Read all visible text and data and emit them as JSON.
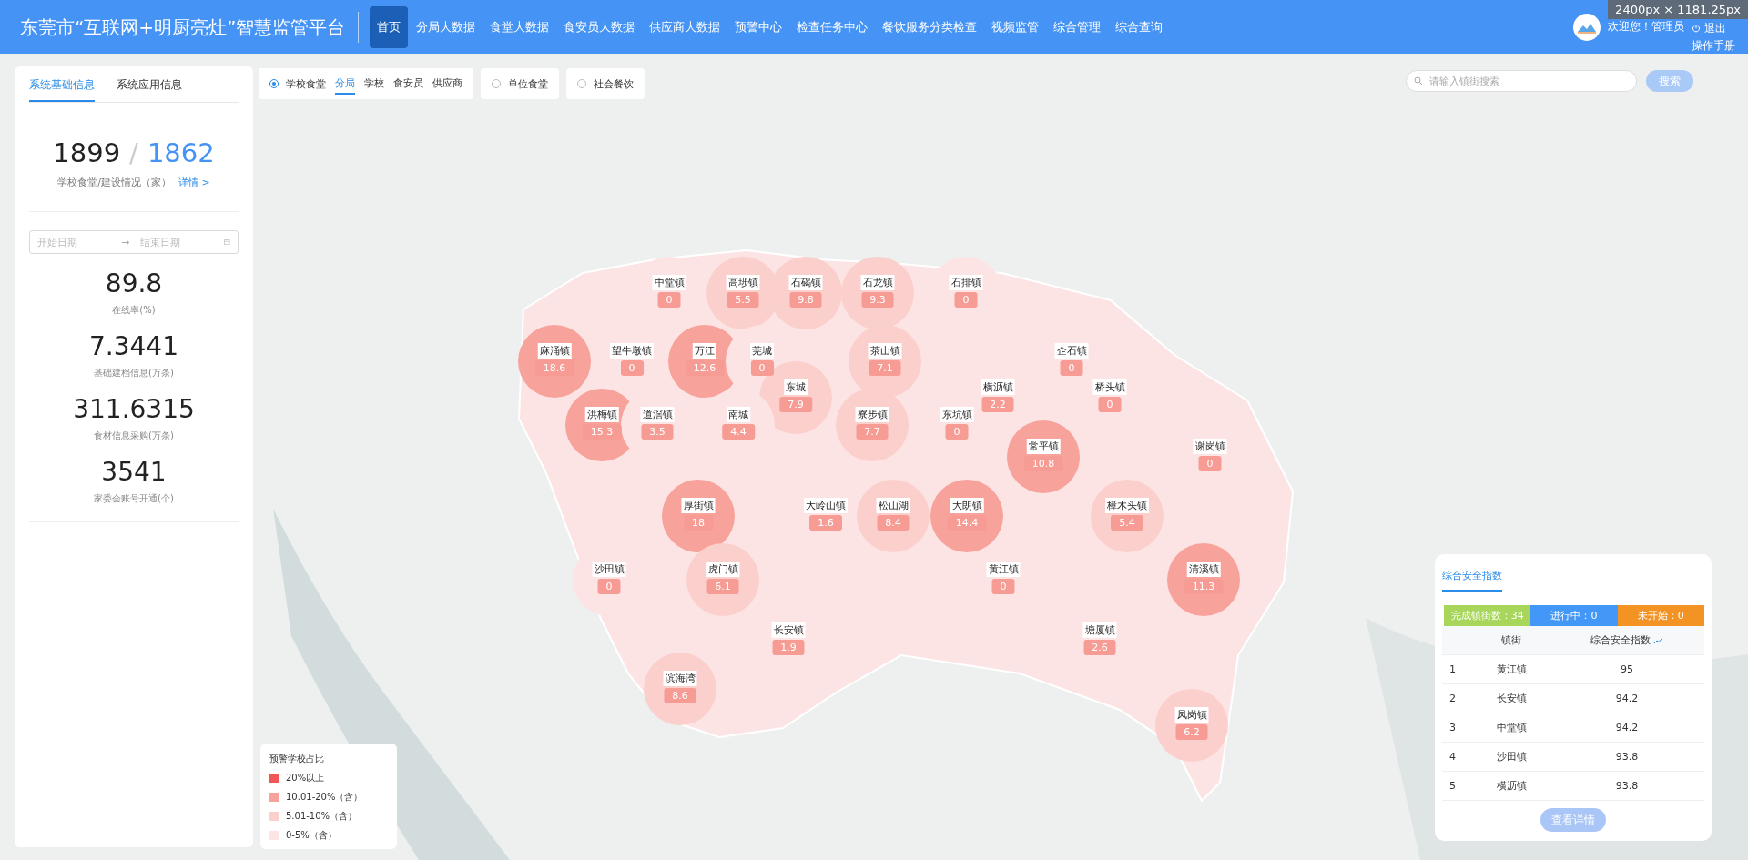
{
  "header": {
    "title": "东莞市“互联网+明厨亮灶”智慧监管平台",
    "nav": [
      {
        "label": "首页",
        "selected": true
      },
      {
        "label": "分局大数据",
        "selected": false
      },
      {
        "label": "食堂大数据",
        "selected": false
      },
      {
        "label": "食安员大数据",
        "selected": false
      },
      {
        "label": "供应商大数据",
        "selected": false
      },
      {
        "label": "预警中心",
        "selected": false
      },
      {
        "label": "检查任务中心",
        "selected": false
      },
      {
        "label": "餐饮服务分类检查",
        "selected": false
      },
      {
        "label": "视频监管",
        "selected": false
      },
      {
        "label": "综合管理",
        "selected": false
      },
      {
        "label": "综合查询",
        "selected": false
      }
    ],
    "welcome": "欢迎您！管理员",
    "logout": "退出",
    "manual": "操作手册"
  },
  "size_tooltip": "2400px × 1181.25px",
  "left_panel": {
    "tabs": [
      {
        "label": "系统基础信息",
        "selected": true
      },
      {
        "label": "系统应用信息",
        "selected": false
      }
    ],
    "total": "1899",
    "separator": "/",
    "built": "1862",
    "summary_label": "学校食堂/建设情况（家）",
    "details_link": "详情 >",
    "date_range": {
      "start_placeholder": "开始日期",
      "arrow": "→",
      "end_placeholder": "结束日期"
    },
    "stats": [
      {
        "value": "89.8",
        "label": "在线率(%)"
      },
      {
        "value": "7.3441",
        "label": "基础建档信息(万条)"
      },
      {
        "value": "311.6315",
        "label": "食材信息采购(万条)"
      },
      {
        "value": "3541",
        "label": "家委会账号开通(个)"
      }
    ]
  },
  "filters": [
    {
      "label": "学校食堂",
      "selected": true,
      "sub_tabs": [
        {
          "label": "分局",
          "selected": true
        },
        {
          "label": "学校",
          "selected": false
        },
        {
          "label": "食安员",
          "selected": false
        },
        {
          "label": "供应商",
          "selected": false
        }
      ]
    },
    {
      "label": "单位食堂",
      "selected": false
    },
    {
      "label": "社会餐饮",
      "selected": false
    }
  ],
  "search": {
    "placeholder": "请输入镇街搜索",
    "button": "搜索"
  },
  "map": {
    "towns": [
      {
        "name": "中堂镇",
        "value": "0",
        "color": "#fde4e4"
      },
      {
        "name": "高埗镇",
        "value": "5.5",
        "color": "#fbcfcc"
      },
      {
        "name": "石碣镇",
        "value": "9.8",
        "color": "#fbcfcc"
      },
      {
        "name": "石龙镇",
        "value": "9.3",
        "color": "#fbcfcc"
      },
      {
        "name": "石排镇",
        "value": "0",
        "color": "#fde4e4"
      },
      {
        "name": "麻涌镇",
        "value": "18.6",
        "color": "#f7a29b"
      },
      {
        "name": "望牛墩镇",
        "value": "0",
        "color": "#fde4e4"
      },
      {
        "name": "万江",
        "value": "12.6",
        "color": "#f7a29b"
      },
      {
        "name": "莞城",
        "value": "0",
        "color": "#fde4e4"
      },
      {
        "name": "茶山镇",
        "value": "7.1",
        "color": "#fbcfcc"
      },
      {
        "name": "企石镇",
        "value": "0",
        "color": "#fde4e4"
      },
      {
        "name": "东城",
        "value": "7.9",
        "color": "#fbcfcc"
      },
      {
        "name": "横沥镇",
        "value": "2.2",
        "color": "#fde4e4"
      },
      {
        "name": "桥头镇",
        "value": "0",
        "color": "#fde4e4"
      },
      {
        "name": "洪梅镇",
        "value": "15.3",
        "color": "#f7a29b"
      },
      {
        "name": "道滘镇",
        "value": "3.5",
        "color": "#fde4e4"
      },
      {
        "name": "南城",
        "value": "4.4",
        "color": "#fde4e4"
      },
      {
        "name": "寮步镇",
        "value": "7.7",
        "color": "#fbcfcc"
      },
      {
        "name": "东坑镇",
        "value": "0",
        "color": "#fde4e4"
      },
      {
        "name": "常平镇",
        "value": "10.8",
        "color": "#f7a29b"
      },
      {
        "name": "谢岗镇",
        "value": "0",
        "color": "#fde4e4"
      },
      {
        "name": "厚街镇",
        "value": "18",
        "color": "#f7a29b"
      },
      {
        "name": "大岭山镇",
        "value": "1.6",
        "color": "#fde4e4"
      },
      {
        "name": "松山湖",
        "value": "8.4",
        "color": "#fbcfcc"
      },
      {
        "name": "大朗镇",
        "value": "14.4",
        "color": "#f7a29b"
      },
      {
        "name": "樟木头镇",
        "value": "5.4",
        "color": "#fbcfcc"
      },
      {
        "name": "沙田镇",
        "value": "0",
        "color": "#fde4e4"
      },
      {
        "name": "虎门镇",
        "value": "6.1",
        "color": "#fbcfcc"
      },
      {
        "name": "黄江镇",
        "value": "0",
        "color": "#fde4e4"
      },
      {
        "name": "清溪镇",
        "value": "11.3",
        "color": "#f7a29b"
      },
      {
        "name": "长安镇",
        "value": "1.9",
        "color": "#fde4e4"
      },
      {
        "name": "塘厦镇",
        "value": "2.6",
        "color": "#fde4e4"
      },
      {
        "name": "滨海湾",
        "value": "8.6",
        "color": "#fbcfcc"
      },
      {
        "name": "凤岗镇",
        "value": "6.2",
        "color": "#fbcfcc"
      }
    ]
  },
  "legend": {
    "title": "预警学校占比",
    "items": [
      {
        "label": "20%以上",
        "color": "#f25757"
      },
      {
        "label": "10.01-20%（含）",
        "color": "#f7a29b"
      },
      {
        "label": "5.01-10%（含）",
        "color": "#fbcfcc"
      },
      {
        "label": "0-5%（含）",
        "color": "#fde4e4"
      }
    ]
  },
  "safety_panel": {
    "tab": "综合安全指数",
    "statuses": [
      {
        "label": "完成镇街数：34",
        "kind": "done"
      },
      {
        "label": "进行中：0",
        "kind": "progress"
      },
      {
        "label": "未开始：0",
        "kind": "pending"
      }
    ],
    "columns": [
      "镇街",
      "综合安全指数"
    ],
    "rows": [
      {
        "rank": "1",
        "town": "黄江镇",
        "score": "95"
      },
      {
        "rank": "2",
        "town": "长安镇",
        "score": "94.2"
      },
      {
        "rank": "3",
        "town": "中堂镇",
        "score": "94.2"
      },
      {
        "rank": "4",
        "town": "沙田镇",
        "score": "93.8"
      },
      {
        "rank": "5",
        "town": "横沥镇",
        "score": "93.8"
      }
    ],
    "button": "查看详情"
  }
}
